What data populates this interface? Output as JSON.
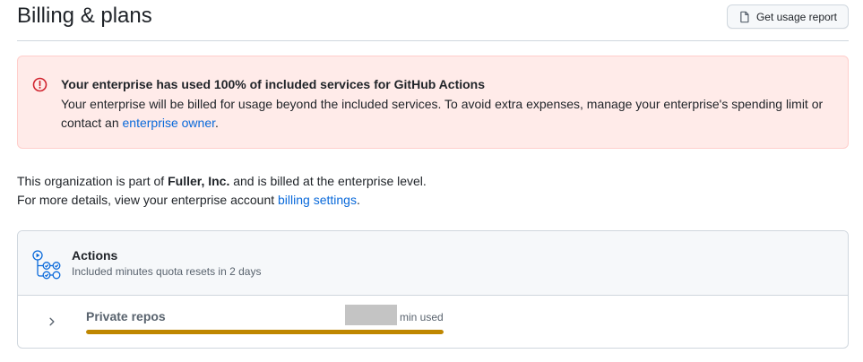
{
  "header": {
    "title": "Billing & plans",
    "usage_button_label": "Get usage report",
    "usage_button_icon": "file-icon"
  },
  "alert": {
    "icon": "alert-circle-icon",
    "title": "Your enterprise has used 100% of included services for GitHub Actions",
    "body_text": "Your enterprise will be billed for usage beyond the included services. To avoid extra expenses, manage your enterprise's spending limit or contact an ",
    "link_text": "enterprise owner",
    "body_end": ".",
    "background_color": "#ffebe9",
    "icon_color": "#d1242f"
  },
  "info": {
    "line1_prefix": "This organization is part of ",
    "org_name": "Fuller, Inc.",
    "line1_suffix": " and is billed at the enterprise level.",
    "line2_prefix": "For more details, view your enterprise account ",
    "line2_link": "billing settings",
    "line2_suffix": "."
  },
  "actions_card": {
    "icon": "actions-workflow-icon",
    "title": "Actions",
    "subtitle": "Included minutes quota resets in 2 days",
    "rows": [
      {
        "label": "Private repos",
        "used_suffix": "min used",
        "progress_fraction": 1.0,
        "progress_color": "#bf8700"
      }
    ]
  },
  "colors": {
    "link": "#0969da",
    "border": "#d0d7de",
    "muted_text": "#59636e"
  }
}
